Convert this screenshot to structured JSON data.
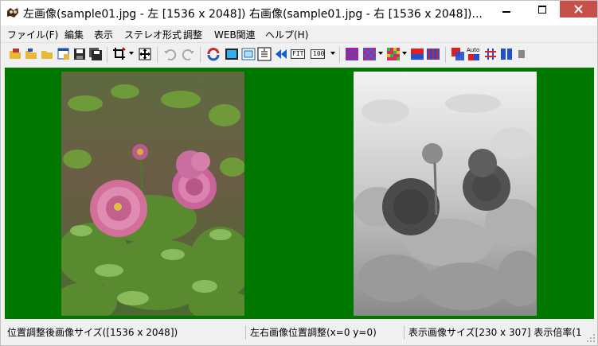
{
  "window": {
    "title": "左画像(sample01.jpg - 左 [1536 x 2048]) 右画像(sample01.jpg - 右 [1536 x 2048])..."
  },
  "menu": {
    "items": [
      "ファイル(F)",
      "編集",
      "表示",
      "ステレオ形式",
      "調整",
      "WEB関連",
      "ヘルプ(H)"
    ]
  },
  "toolbar": {
    "fit_label": "FIT",
    "zoom100_label": "100",
    "auto_label": "Auto"
  },
  "status": {
    "adjusted_size": "位置調整後画像サイズ([1536 x 2048])",
    "position": "左右画像位置調整(x=0 y=0)",
    "display": "表示画像サイズ[230 x 307]  表示倍率(1"
  },
  "colors": {
    "background": "#007800",
    "close": "#c7504b"
  }
}
